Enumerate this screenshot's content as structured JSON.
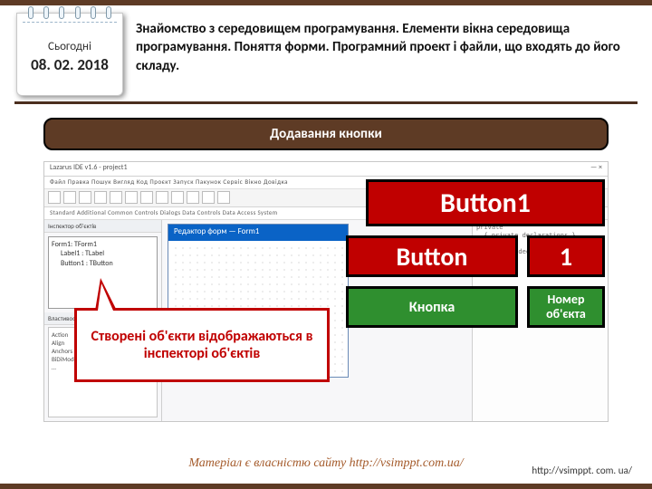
{
  "header": {
    "today_label": "Сьогодні",
    "date": "08. 02. 2018",
    "title": "Знайомство з середовищем програмування. Елементи вікна середовища програмування. Поняття форми. Програмний проект і файли, що входять до його складу."
  },
  "ribbon": {
    "text": "Додавання кнопки"
  },
  "ide": {
    "window_title_left": "Lazarus IDE v1.6 - project1",
    "window_title_right": "— × ",
    "menu": "Файл  Правка  Пошук  Вигляд  Код  Проєкт  Запуск  Пакунок  Сервіс  Вікно  Довідка",
    "palette": "Standard   Additional   Common Controls   Dialogs   Data Controls   Data Access   System",
    "inspector_title": "Інспектор об'єктів",
    "tree_root": "Form1: TForm1",
    "tree_children": [
      "Label1 : TLabel",
      "Button1 : TButton"
    ],
    "props_title": "Властивості | Події | Обране",
    "props_items": [
      "Action",
      "Align",
      "Anchors",
      "BiDiMode",
      "…"
    ],
    "form_window_title": "Редактор форм — Form1",
    "source_snippet": "private\n  { private declarations }\npublic\n  { public declarations }\nend;"
  },
  "chips": {
    "big": "Button1",
    "button": "Button",
    "one": "1",
    "knopka": "Кнопка",
    "number_label": "Номер об'єкта"
  },
  "callout": {
    "text": "Створені об'єкти відображаються в інспекторі об'єктів"
  },
  "footer": {
    "center": "Матеріал є власністю сайту http://vsimppt.com.ua/",
    "right_prefix": "http://vsimppt. com. ua/",
    "right_url": "http://vsimppt.com.ua/"
  }
}
